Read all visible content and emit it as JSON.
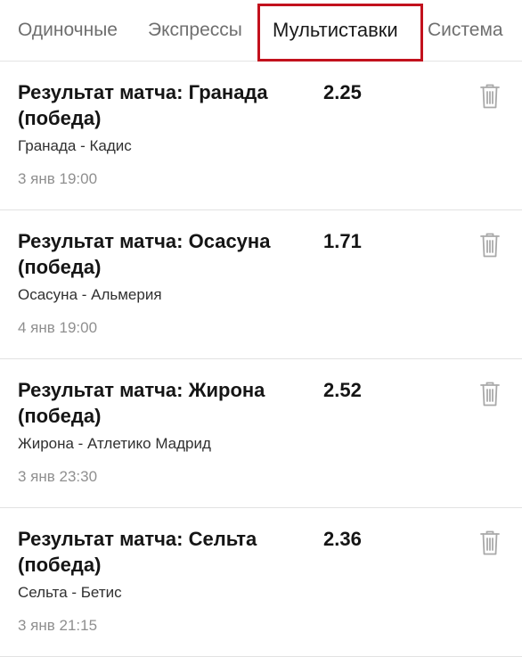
{
  "tabs": [
    {
      "label": "Одиночные",
      "active": false
    },
    {
      "label": "Экспрессы",
      "active": false
    },
    {
      "label": "Мультиставки",
      "active": true
    },
    {
      "label": "Система",
      "active": false
    }
  ],
  "bets": [
    {
      "market": "Результат матча: Гранада (победа)",
      "odds": "2.25",
      "teams": "Гранада - Кадис",
      "time": "3 янв 19:00"
    },
    {
      "market": "Результат матча: Осасуна (победа)",
      "odds": "1.71",
      "teams": "Осасуна - Альмерия",
      "time": "4 янв 19:00"
    },
    {
      "market": "Результат матча: Жирона (победа)",
      "odds": "2.52",
      "teams": "Жирона - Атлетико Мадрид",
      "time": "3 янв 23:30"
    },
    {
      "market": "Результат матча: Сельта (победа)",
      "odds": "2.36",
      "teams": "Сельта - Бетис",
      "time": "3 янв 21:15"
    }
  ],
  "colors": {
    "highlight": "#c2111d",
    "tab_inactive": "#6f6f6f",
    "muted_text": "#8f8f8f",
    "trash_icon": "#a9a9a9"
  },
  "icons": {
    "delete": "trash-icon"
  }
}
